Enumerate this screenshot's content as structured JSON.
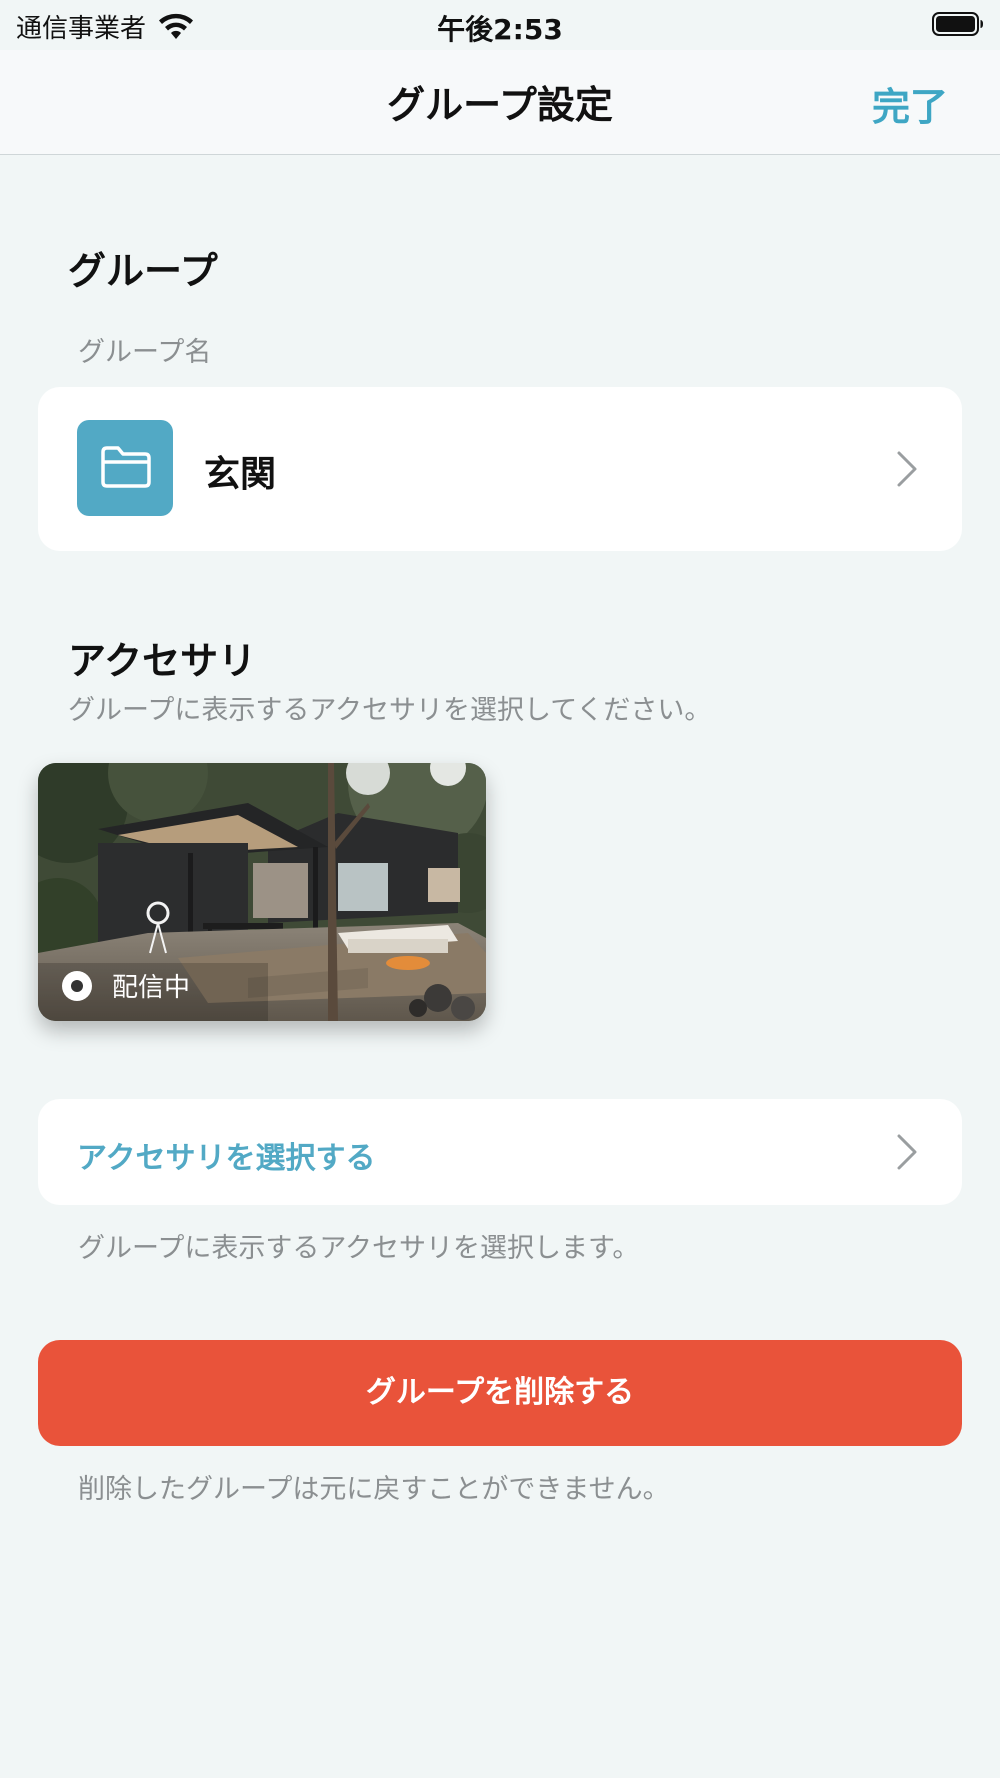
{
  "status_bar": {
    "carrier": "通信事業者",
    "time": "午後2:53"
  },
  "nav": {
    "title": "グループ設定",
    "done_label": "完了"
  },
  "group_section": {
    "title": "グループ",
    "name_caption": "グループ名",
    "group_name": "玄関",
    "icon": "folder-icon"
  },
  "accessory_section": {
    "title": "アクセサリ",
    "description": "グループに表示するアクセサリを選択してください。",
    "accessories": [
      {
        "status_label": "配信中"
      }
    ],
    "select_label": "アクセサリを選択する",
    "select_footnote": "グループに表示するアクセサリを選択します。"
  },
  "delete": {
    "button_label": "グループを削除する",
    "footnote": "削除したグループは元に戻すことができません。"
  },
  "colors": {
    "accent": "#3ea6c4",
    "folder_tile": "#52a9c5",
    "destructive": "#e9533a",
    "background": "#f1f6f6"
  }
}
